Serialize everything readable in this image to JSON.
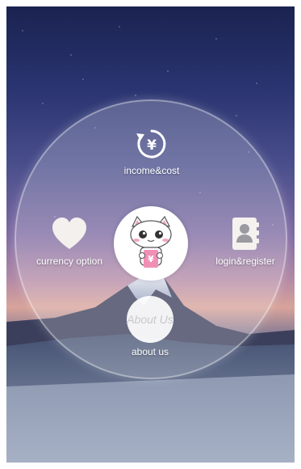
{
  "menu": {
    "income": {
      "label": "income&cost",
      "icon": "yen-refresh-icon"
    },
    "currency": {
      "label": "currency option",
      "icon": "heart-icon"
    },
    "login": {
      "label": "login&register",
      "icon": "contact-book-icon"
    },
    "about": {
      "label": "about us",
      "icon_text": "About Us"
    },
    "center": {
      "icon": "cat-mascot-icon"
    }
  },
  "colors": {
    "glass": "#ffffff",
    "label": "#ffffff",
    "mascot_pink": "#f2a7c4"
  }
}
